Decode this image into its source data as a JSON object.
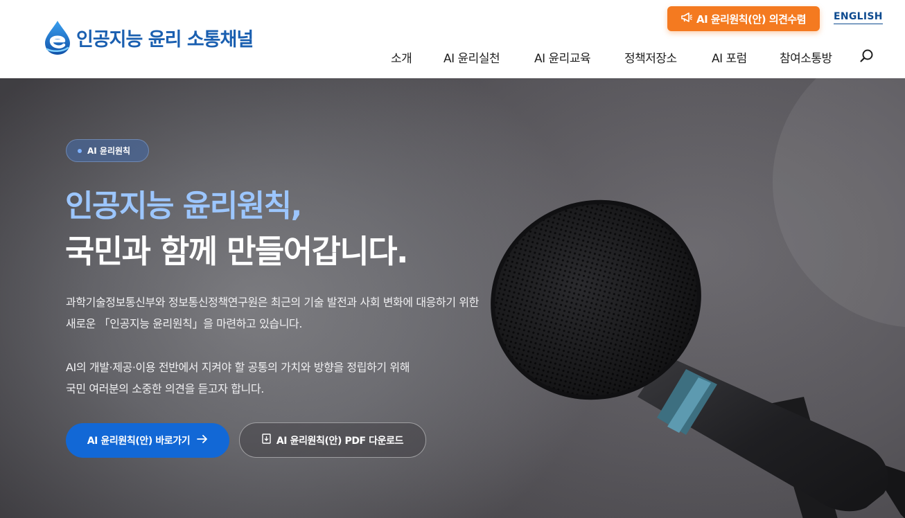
{
  "header": {
    "logo_text": "인공지능 윤리 소통채널",
    "logo_icon": "water-drop-e-logo",
    "opinion_button_label": "AI 윤리원칙(안) 의견수렴",
    "opinion_button_icon": "megaphone-icon",
    "english_link": "ENGLISH",
    "search_icon": "search-icon"
  },
  "nav": {
    "items": [
      {
        "label": "소개"
      },
      {
        "label": "AI 윤리실천"
      },
      {
        "label": "AI 윤리교육"
      },
      {
        "label": "정책저장소"
      },
      {
        "label": "AI 포럼"
      },
      {
        "label": "참여소통방"
      }
    ]
  },
  "hero": {
    "badge": "AI 윤리원칙",
    "headline_1": "인공지능 윤리원칙,",
    "headline_2": "국민과 함께 만들어갑니다.",
    "description": [
      "과학기술정보통신부와 정보통신정책연구원은 최근의 기술 발전과 사회 변화에 대응하기 위한",
      "새로운 「인공지능 윤리원칙」을 마련하고 있습니다.",
      "AI의 개발·제공·이용 전반에서 지켜야 할 공통의 가치와 방향을 정립하기 위해",
      "국민 여러분의 소중한 의견을 듣고자 합니다."
    ],
    "primary_button": "AI 윤리원칙(안) 바로가기",
    "primary_button_icon": "arrow-right-icon",
    "secondary_button": "AI 윤리원칙(안) PDF 다운로드",
    "secondary_button_icon": "document-download-icon"
  },
  "colors": {
    "brand_blue": "#1a5fb0",
    "accent_orange": "#f47a20",
    "cta_blue": "#1268d6",
    "headline_light_blue": "#9cc6ff"
  }
}
